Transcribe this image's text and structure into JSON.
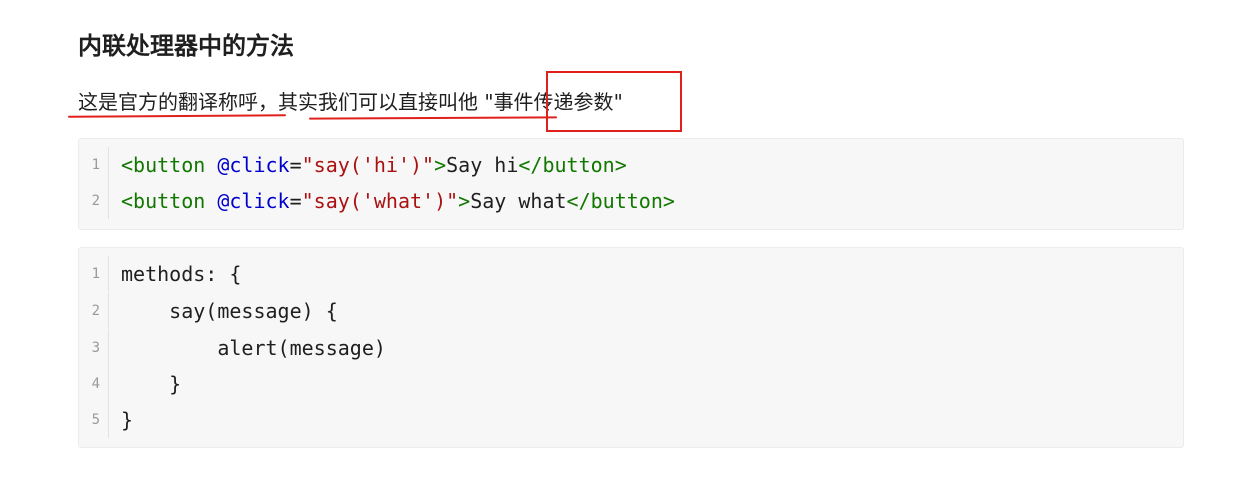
{
  "heading": "内联处理器中的方法",
  "paragraph": {
    "part1": "这是官方的翻译称呼，",
    "part2": "其实我们可以直接叫他",
    "quote_open": " \"",
    "highlight": "事件传递参数",
    "quote_close": "\""
  },
  "annotation_color": "#e0201b",
  "code_block_1": {
    "line_numbers": [
      "1",
      "2"
    ],
    "lines": [
      {
        "tag_open": "<button ",
        "attr": "@click",
        "eq": "=",
        "str": "\"say('hi')\"",
        "gt": ">",
        "text": "Say hi",
        "tag_close": "</button>"
      },
      {
        "tag_open": "<button ",
        "attr": "@click",
        "eq": "=",
        "str": "\"say('what')\"",
        "gt": ">",
        "text": "Say what",
        "tag_close": "</button>"
      }
    ]
  },
  "code_block_2": {
    "line_numbers": [
      "1",
      "2",
      "3",
      "4",
      "5"
    ],
    "lines": [
      "methods: {",
      "    say(message) {",
      "        alert(message)",
      "    }",
      "}"
    ]
  }
}
